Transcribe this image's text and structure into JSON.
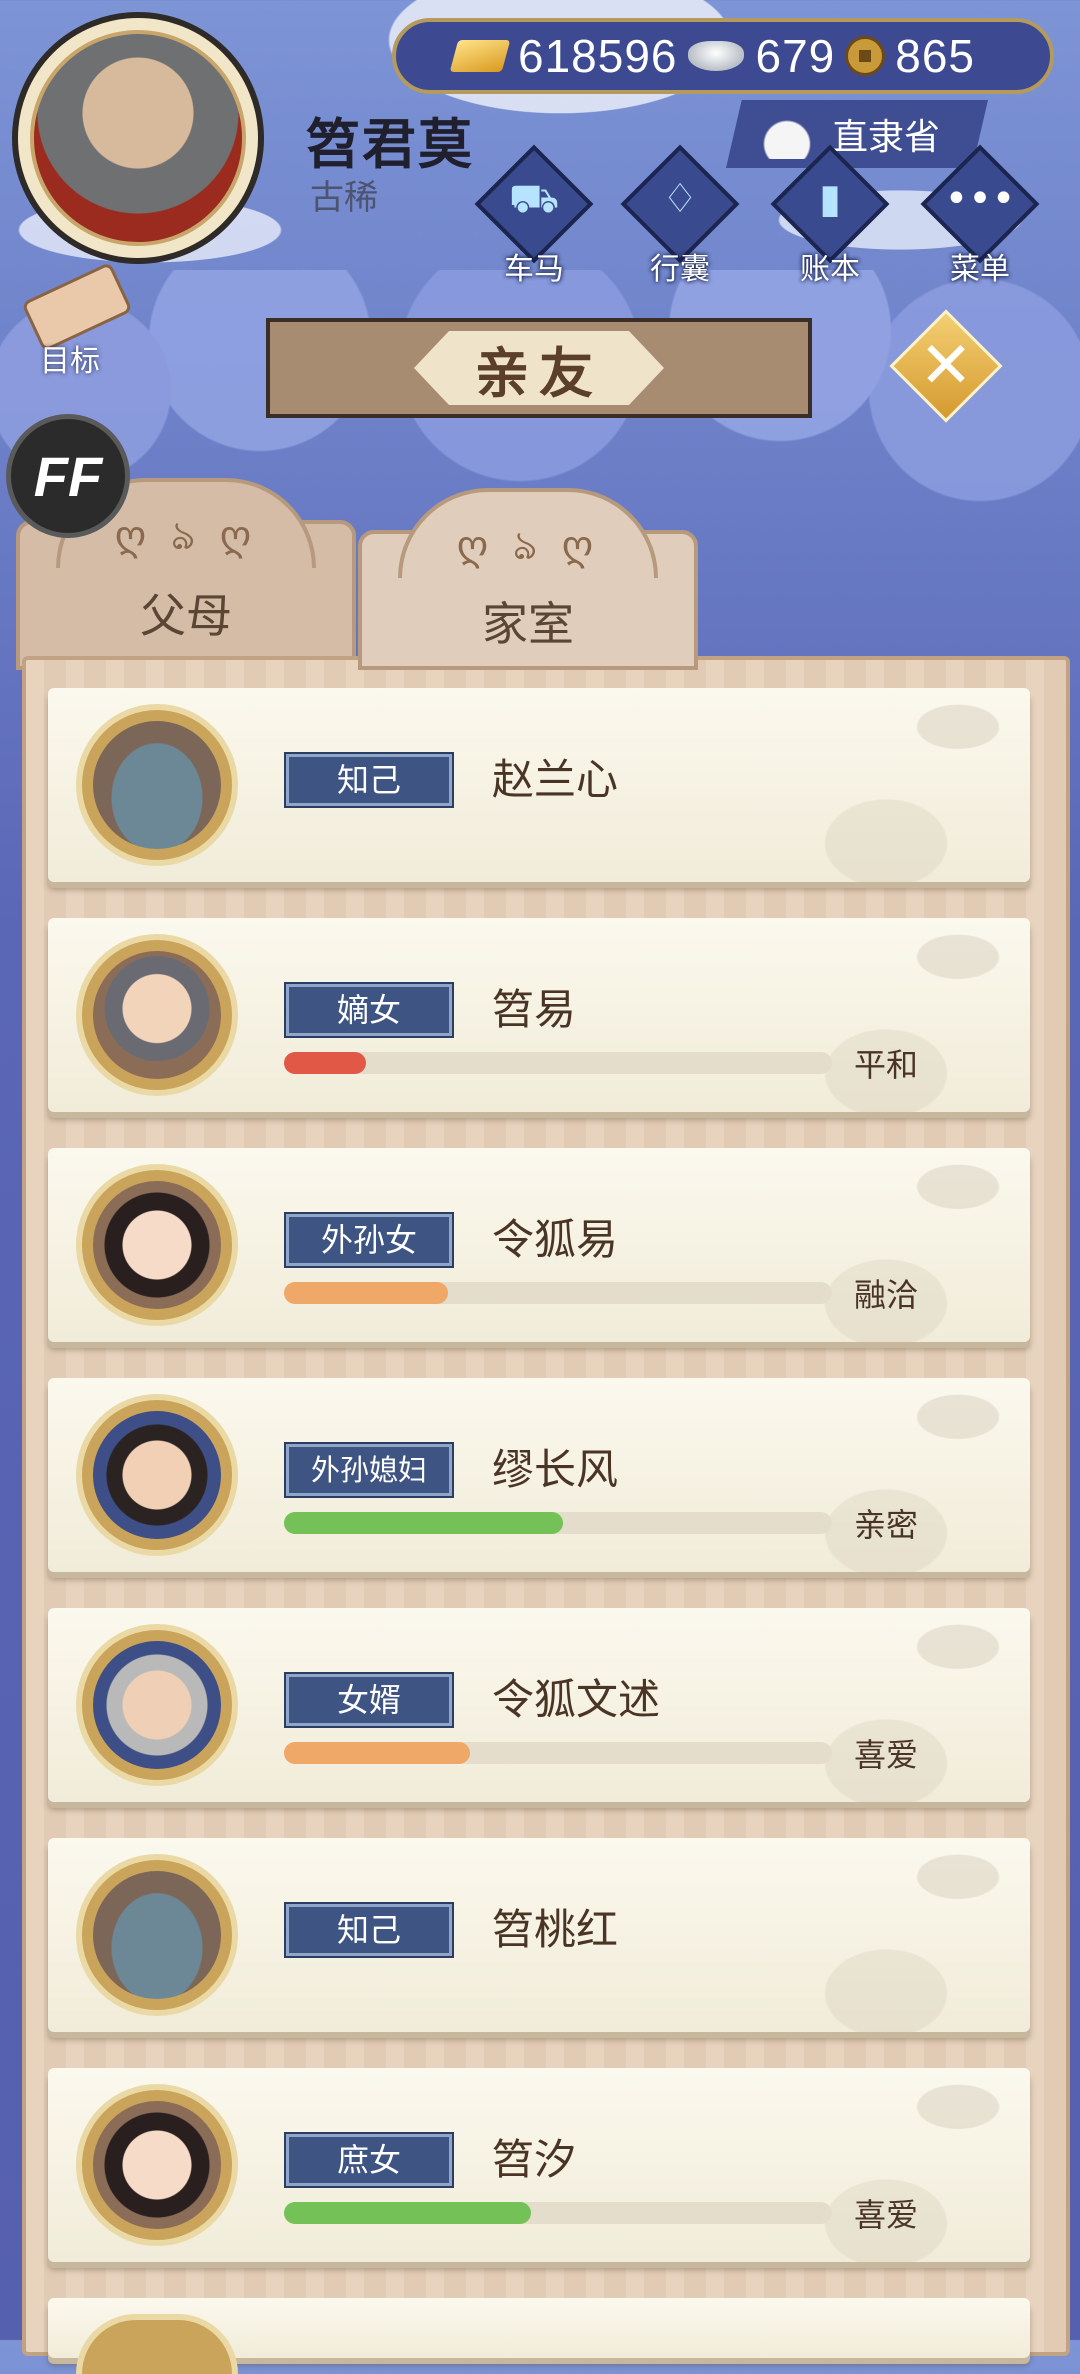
{
  "player": {
    "name": "笤君莫",
    "age_label": "古稀"
  },
  "currency": {
    "gold": "618596",
    "silver": "679",
    "coins": "865"
  },
  "region": {
    "label": "直隶省"
  },
  "menu": [
    {
      "label": "车马",
      "icon": "carriage-icon"
    },
    {
      "label": "行囊",
      "icon": "bag-icon"
    },
    {
      "label": "账本",
      "icon": "ledger-icon"
    },
    {
      "label": "菜单",
      "icon": "more-icon"
    }
  ],
  "goal_label": "目标",
  "title": "亲友",
  "ff_label": "FF",
  "tabs": [
    {
      "label": "父母",
      "active": false
    },
    {
      "label": "家室",
      "active": true
    }
  ],
  "members": [
    {
      "role": "知己",
      "name": "赵兰心",
      "relation": "",
      "level": null,
      "bar_color": ""
    },
    {
      "role": "嫡女",
      "name": "笤易",
      "relation": "平和",
      "level": 0.15,
      "bar_color": "#e25847"
    },
    {
      "role": "外孙女",
      "name": "令狐易",
      "relation": "融洽",
      "level": 0.3,
      "bar_color": "#f0a868"
    },
    {
      "role": "外孙媳妇",
      "name": "缪长风",
      "relation": "亲密",
      "level": 0.51,
      "bar_color": "#74c257"
    },
    {
      "role": "女婿",
      "name": "令狐文述",
      "relation": "喜爱",
      "level": 0.34,
      "bar_color": "#f0a868"
    },
    {
      "role": "知己",
      "name": "笤桃红",
      "relation": "",
      "level": null,
      "bar_color": ""
    },
    {
      "role": "庶女",
      "name": "笤汐",
      "relation": "喜爱",
      "level": 0.45,
      "bar_color": "#74c257"
    }
  ]
}
